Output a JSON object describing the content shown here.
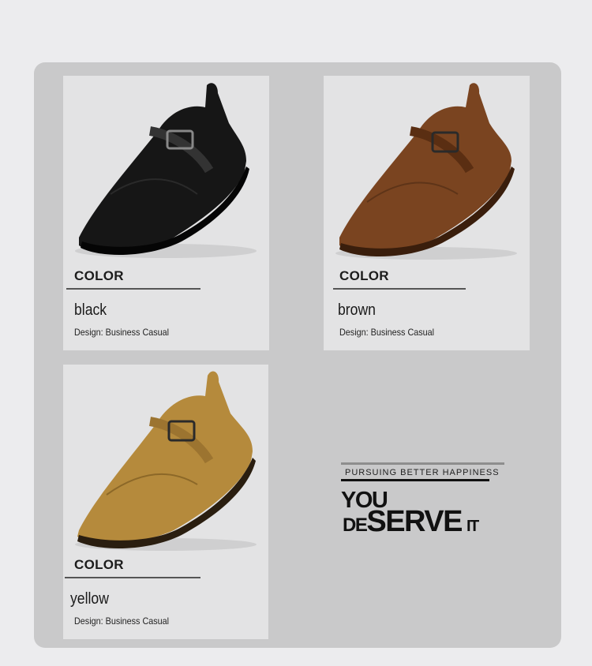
{
  "products": [
    {
      "color_title": "COLOR",
      "color_name": "black",
      "design": "Design: Business Casual",
      "shoe_color": "#161616"
    },
    {
      "color_title": "COLOR",
      "color_name": "brown",
      "design": "Design: Business Casual",
      "shoe_color": "#7a4420"
    },
    {
      "color_title": "COLOR",
      "color_name": "yellow",
      "design": "Design: Business Casual",
      "shoe_color": "#b58a3c"
    }
  ],
  "slogan": {
    "tagline": "PURSUING BETTER HAPPINESS",
    "line1": "YOU",
    "line2_a": "DE",
    "line2_b": "SERVE",
    "line2_c": "IT"
  }
}
